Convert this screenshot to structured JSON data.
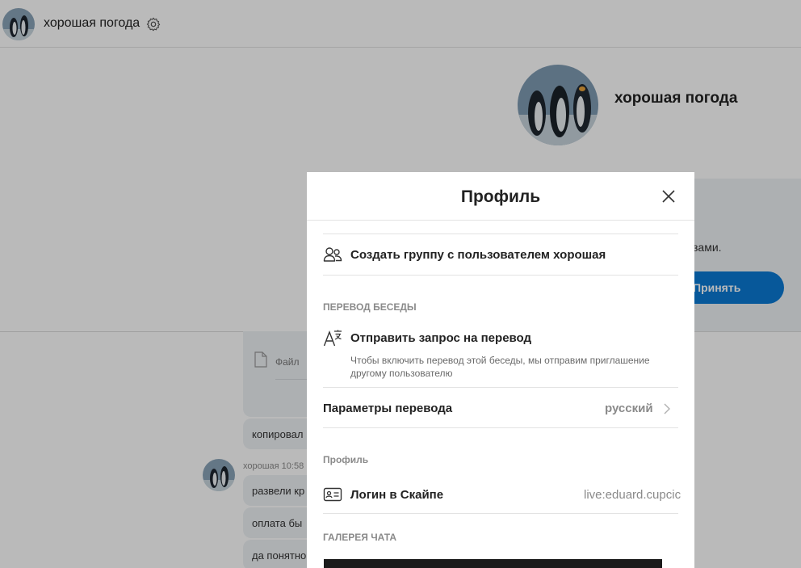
{
  "header": {
    "contact_name": "хорошая погода"
  },
  "profile_hero": {
    "name": "хорошая погода"
  },
  "invite": {
    "text_fragment": "зами.",
    "accept_label": "Принять",
    "accent_color": "#0a79d4"
  },
  "chat": {
    "file_label": "Файл",
    "sender_meta": "хорошая 10:58",
    "messages": [
      "копировал",
      "развели кр",
      "оплата бы",
      "да понятно"
    ]
  },
  "modal": {
    "title": "Профиль",
    "create_group_label": "Создать группу с пользователем хорошая",
    "translation_section": "ПЕРЕВОД БЕСЕДЫ",
    "send_request_label": "Отправить запрос на перевод",
    "send_request_description": "Чтобы включить перевод этой беседы, мы отправим приглашение другому пользователю",
    "translation_params_label": "Параметры перевода",
    "translation_params_value": "русский",
    "profile_section": "Профиль",
    "skype_login_label": "Логин в Скайпе",
    "skype_login_value": "live:eduard.cupcic",
    "gallery_section": "ГАЛЕРЕЯ ЧАТА"
  },
  "icons": [
    "gear-icon",
    "close-icon",
    "people-icon",
    "translate-icon",
    "chevron-right-icon",
    "id-card-icon",
    "file-icon"
  ]
}
